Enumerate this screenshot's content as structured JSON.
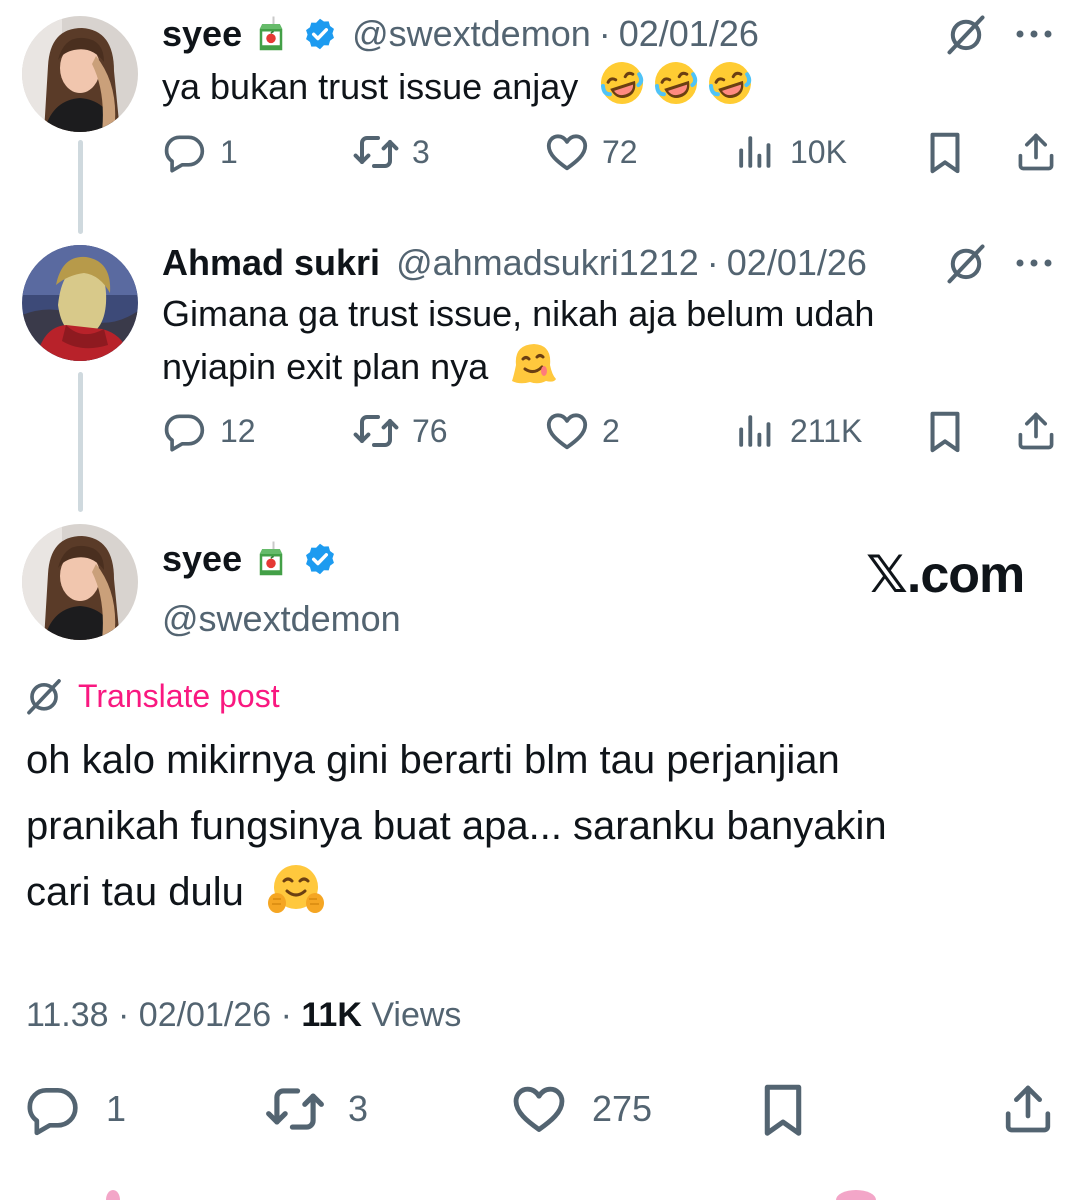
{
  "tweets": [
    {
      "name": "syee",
      "juice_emoji": "🧃",
      "verified": true,
      "handle": "@swextdemon",
      "separator": "·",
      "date": "02/01/26",
      "text_lines": [
        "ya bukan trust issue anjay"
      ],
      "trailing_emoji": [
        "🤣",
        "🤣",
        "🤣"
      ],
      "stats": {
        "replies": "1",
        "reposts": "3",
        "likes": "72",
        "views": "10K"
      }
    },
    {
      "name": "Ahmad sukri",
      "handle": "@ahmadsukri1212",
      "separator": "·",
      "date": "02/01/26",
      "text_lines": [
        "Gimana ga trust issue, nikah aja belum udah",
        "nyiapin exit plan nya"
      ],
      "trailing_emoji": [
        "🫠"
      ],
      "stats": {
        "replies": "12",
        "reposts": "76",
        "likes": "2",
        "views": "211K"
      }
    }
  ],
  "main": {
    "name": "syee",
    "juice_emoji": "🧃",
    "verified": true,
    "handle": "@swextdemon",
    "watermark": "𝕏.com",
    "translate_label": "Translate post",
    "text_lines": [
      "oh kalo mikirnya gini berarti blm tau perjanjian",
      "pranikah fungsinya buat apa... saranku banyakin",
      "cari tau dulu"
    ],
    "trailing_emoji": [
      "🤗"
    ],
    "time": "11.38",
    "separator": "·",
    "date": "02/01/26",
    "views_count": "11K",
    "views_label": "Views",
    "stats": {
      "replies": "1",
      "reposts": "3",
      "likes": "275"
    }
  },
  "icons": [
    "reply-icon",
    "repost-icon",
    "like-icon",
    "views-icon",
    "bookmark-icon",
    "share-icon",
    "grok-icon",
    "more-icon",
    "verified-badge-icon"
  ],
  "colors": {
    "text": "#0f1419",
    "secondary": "#536471",
    "verified": "#1d9bf0",
    "translate": "#f91880",
    "thread_line": "#cfd9de"
  }
}
